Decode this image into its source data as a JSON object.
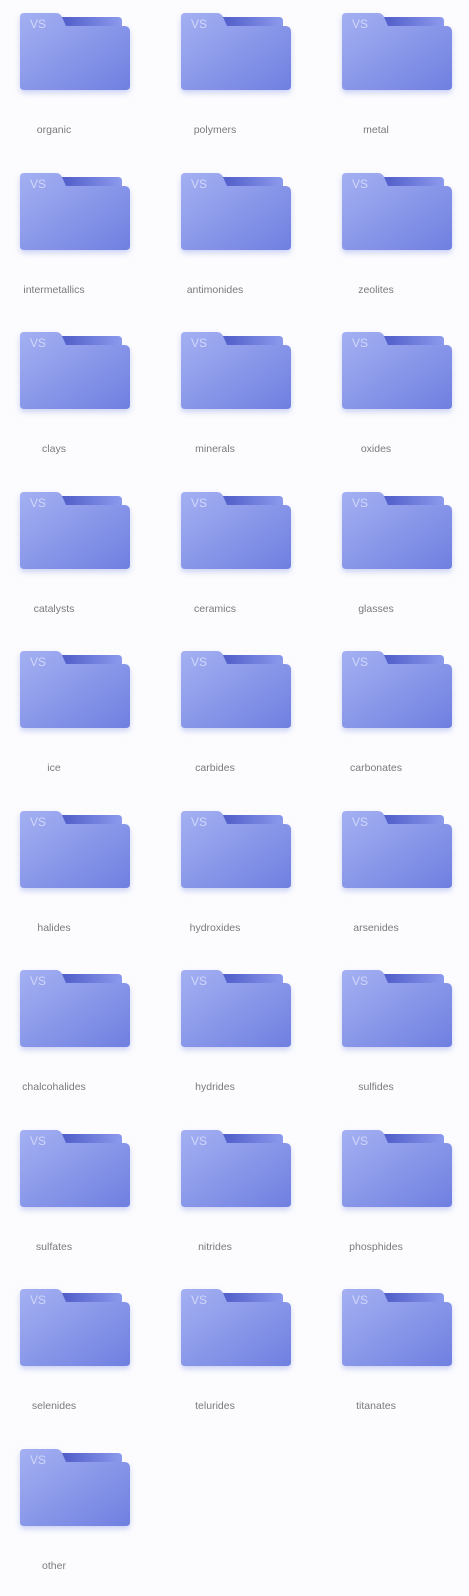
{
  "folder_badge": "VS",
  "colors": {
    "folder_body_top": "#a4b0f2",
    "folder_body_bottom": "#6f7fe0",
    "folder_tab": "#8d9bed",
    "folder_back_dark": "#4f5cc8",
    "label": "#7a7a7a",
    "background": "#fcfcfe"
  },
  "icon": "folder-icon",
  "folders": [
    {
      "label": "organic"
    },
    {
      "label": "polymers"
    },
    {
      "label": "metal"
    },
    {
      "label": "intermetallics"
    },
    {
      "label": "antimonides"
    },
    {
      "label": "zeolites"
    },
    {
      "label": "clays"
    },
    {
      "label": "minerals"
    },
    {
      "label": "oxides"
    },
    {
      "label": "catalysts"
    },
    {
      "label": "ceramics"
    },
    {
      "label": "glasses"
    },
    {
      "label": "ice"
    },
    {
      "label": "carbides"
    },
    {
      "label": "carbonates"
    },
    {
      "label": "halides"
    },
    {
      "label": "hydroxides"
    },
    {
      "label": "arsenides"
    },
    {
      "label": "chalcohalides"
    },
    {
      "label": "hydrides"
    },
    {
      "label": "sulfides"
    },
    {
      "label": "sulfates"
    },
    {
      "label": "nitrides"
    },
    {
      "label": "phosphides"
    },
    {
      "label": "selenides"
    },
    {
      "label": "telurides"
    },
    {
      "label": "titanates"
    },
    {
      "label": "other"
    }
  ]
}
